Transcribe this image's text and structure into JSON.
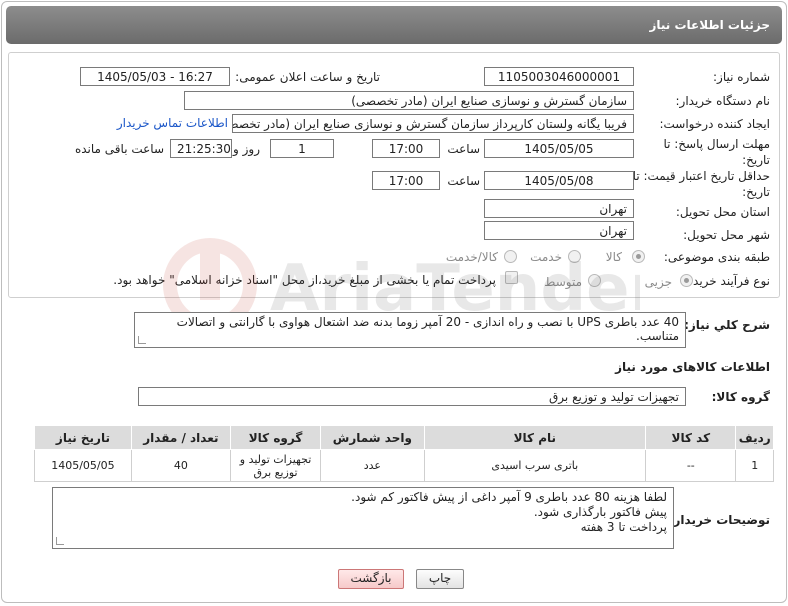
{
  "header": {
    "title": "جزئیات اطلاعات نیاز"
  },
  "form": {
    "need_number": {
      "label": "شماره نیاز:",
      "value": "1105003046000001"
    },
    "announce_datetime": {
      "label": "تاریخ و ساعت اعلان عمومی:",
      "value": "1405/05/03 - 16:27"
    },
    "buyer_org": {
      "label": "نام دستگاه خریدار:",
      "value": "سازمان گسترش و نوسازی صنایع ایران (مادر تخصصی)"
    },
    "requester": {
      "label": "ایجاد کننده درخواست:",
      "value": "فریبا یگانه ولستان کارپرداز سازمان گسترش و نوسازی صنایع ایران (مادر تخصصی)",
      "contact_link": "اطلاعات تماس خریدار"
    },
    "response_deadline": {
      "label": "مهلت ارسال پاسخ: تا تاریخ:",
      "date": "1405/05/05",
      "time_label": "ساعت",
      "time": "17:00",
      "days": "1",
      "days_label": "روز و",
      "remaining": "21:25:30",
      "remaining_label": "ساعت باقی مانده"
    },
    "price_validity": {
      "label": "حداقل تاریخ اعتبار قیمت: تا تاریخ:",
      "date": "1405/05/08",
      "time_label": "ساعت",
      "time": "17:00"
    },
    "delivery_province": {
      "label": "استان محل تحویل:",
      "value": "تهران"
    },
    "delivery_city": {
      "label": "شهر محل تحویل:",
      "value": "تهران"
    },
    "category": {
      "label": "طبقه بندی موضوعی:",
      "options": [
        "کالا",
        "خدمت",
        "کالا/خدمت"
      ],
      "selected": "کالا"
    },
    "purchase_process": {
      "label": "نوع فرآیند خرید :",
      "options": [
        "جزیی",
        "متوسط"
      ],
      "selected": "جزیی",
      "payment_note": "پرداخت تمام یا بخشی از مبلغ خرید،از محل \"اسناد خزانه اسلامی\" خواهد بود."
    }
  },
  "general_description": {
    "label": "شرح کلي نياز:",
    "value": "40 عدد باطری UPS با نصب و راه اندازی - 20 آمپر زوما بدنه ضد اشتعال هواوی با گارانتی و اتصالات متناسب."
  },
  "goods_section": {
    "title": "اطلاعات کالاهای مورد نیاز",
    "group_label": "گروه کالا:",
    "group_value": "تجهیزات تولید و توزیع برق"
  },
  "items_table": {
    "headers": [
      "ردیف",
      "کد کالا",
      "نام کالا",
      "واحد شمارش",
      "گروه کالا",
      "تعداد / مقدار",
      "تاریخ نیاز"
    ],
    "rows": [
      {
        "row": "1",
        "code": "--",
        "name": "باتری سرب اسیدی",
        "unit": "عدد",
        "group": "تجهیزات تولید و توزیع برق",
        "qty": "40",
        "date": "1405/05/05"
      }
    ]
  },
  "buyer_notes": {
    "label": "توضیحات خریدار:",
    "lines": [
      "لطفا هزینه 80 عدد باطری 9 آمپر داغی از پیش فاکتور کم شود.",
      "پیش فاکتور بارگذاری شود.",
      "پرداخت تا 3 هفته"
    ]
  },
  "buttons": {
    "print": "چاپ",
    "back": "بازگشت"
  },
  "watermark": {
    "text": "AriaTender.neT"
  },
  "colors": {
    "header_bg": "#7a7a7a",
    "link": "#1a56c8",
    "back_button": "#f6c9c9"
  }
}
